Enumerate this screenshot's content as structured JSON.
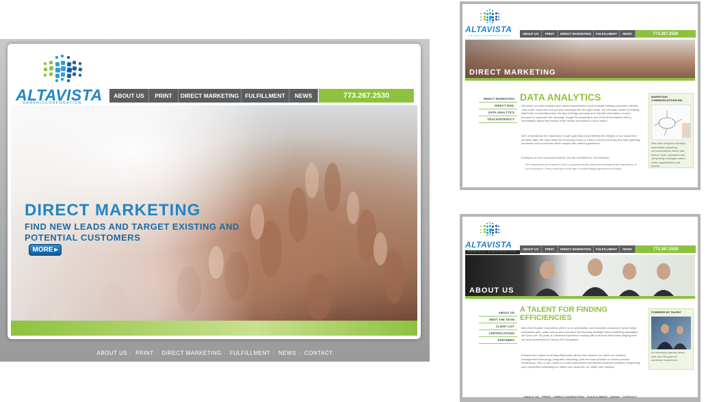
{
  "brand": {
    "name": "ALTAVISTA",
    "tagline": "GRAPHICCORPORATION",
    "tagline_spaced": "GRAPHIC CORPORATION"
  },
  "nav": [
    "ABOUT US",
    "PRINT",
    "DIRECT MARKETING",
    "FULFILLMENT",
    "NEWS"
  ],
  "phone": "773.267.2530",
  "hero": {
    "title": "DIRECT MARKETING",
    "subtitle": "FIND NEW LEADS AND TARGET EXISTING AND POTENTIAL CUSTOMERS",
    "more_label": "MORE"
  },
  "footer_links": [
    "ABOUT US",
    "PRINT",
    "DIRECT MARKETING",
    "FULFILLMENT",
    "NEWS",
    "CONTACT"
  ],
  "dm_page": {
    "banner_label": "DIRECT MARKETING",
    "side_menu": [
      "DIRECT MARKETING",
      "DIRECT MAIL",
      "DATA ANALYTICS",
      "TRACK/INTERACT"
    ],
    "heading": "DATA ANALYTICS",
    "para1": "We utilize our data analytics and market segmentation tools to target existing customers, identify 'look-a-like' customers and get your message into the right hands. We eliminate 'waste' by limiting distribution to potential leads. We also leverage personal and relevant information on each prospect to customize the message. Image Personalization and Purls (Personalized URLs) immediately attract the interest of the reader and deliver a call to action.",
    "para2": "AGC understands the importance of safe guarding and protecting the integrity of our customers' sensitive data. We have taken the necessary steps to create a series of privacy and safe guarding processes and procedures which comply with national guidelines.",
    "para3": "Examples of such processes include, but are not limited to, the following:",
    "bullet1": "Our employees are trained in how to properly handle data and understand the importance of non-disclosure. Every employee must sign a confidentiality agreement annually.",
    "aside_title": "MARKETING COMMUNICATIONS MIX",
    "aside_text": "Alta Vista Graphics carefully assembles marketing communications mixes that deliver clear, consistent and compelling messages about client organizations and brands."
  },
  "about_page": {
    "banner_label": "ABOUT US",
    "side_menu": [
      "ABOUT US",
      "MEET THE TEAM",
      "CLIENT LIST",
      "CERTIFICATIONS",
      "PARTNERS"
    ],
    "heading": "A TALENT FOR FINDING EFFICIENCIES",
    "para1": "Alta Vista Graphic Corporation (AGC) is an optimization and execution company of which helps companies gain, retain and up-sell customers by executing strategic direct marketing campaigns. We have over 35 years of combined experience working with a diverse client base ranging from mid size businesses to Fortune 500 companies.",
    "para2": "Powered by a talent for finding efficiencies others have missed, we utilize our workflow management technology, integrated marketing, print and mail solutions to reduce process redundancy. This, in turn, leads to a more streamlined and efficient business workflow, sharpening your competitive advantage no matter your business, no matter your industry.",
    "aside_title": "POWERED BY TALENT",
    "aside_text": "An extremely talented team with over 35 years of combined experience."
  },
  "colors": {
    "brand_blue": "#1f86c7",
    "brand_green": "#8dc23e",
    "nav_gray": "#5b5d5f"
  }
}
